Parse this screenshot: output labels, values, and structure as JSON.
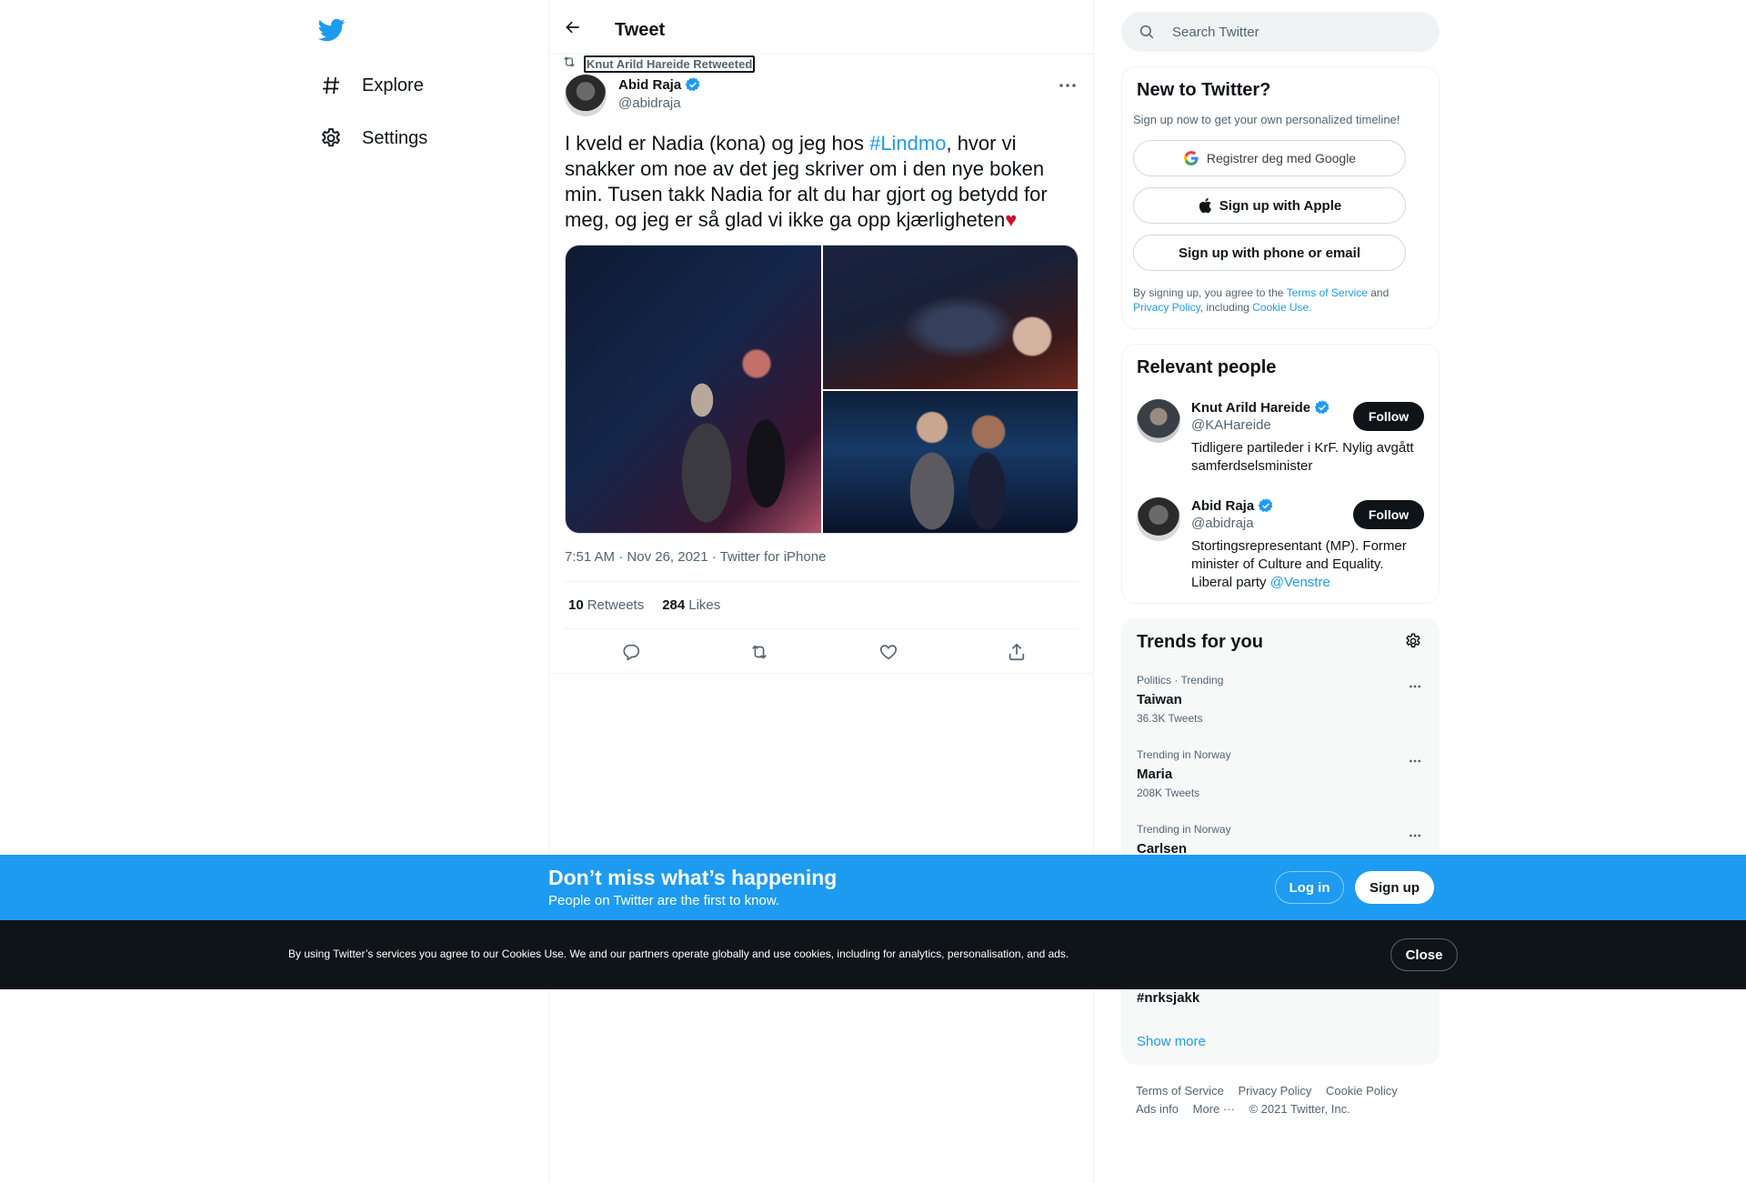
{
  "nav": {
    "explore_label": "Explore",
    "settings_label": "Settings"
  },
  "header": {
    "title": "Tweet"
  },
  "tweet": {
    "retweeted_by": "Knut Arild Hareide Retweeted",
    "author_name": "Abid Raja",
    "author_handle": "@abidraja",
    "text_part1": "I kveld er Nadia (kona) og jeg hos ",
    "hashtag": "#Lindmo",
    "text_part2": ", hvor vi snakker om noe av det jeg skriver om i den nye boken min. Tusen takk Nadia for alt du har gjort og betydd for meg, og jeg er så glad vi ikke ga opp kjærligheten",
    "emoji": "♥",
    "time": "7:51 AM",
    "date": "Nov 26, 2021",
    "source": "Twitter for iPhone",
    "retweets_count": "10",
    "retweets_label": "Retweets",
    "likes_count": "284",
    "likes_label": "Likes"
  },
  "search": {
    "placeholder": "Search Twitter"
  },
  "new_to_twitter": {
    "title": "New to Twitter?",
    "subtitle": "Sign up now to get your own personalized timeline!",
    "google_label": "Registrer deg med Google",
    "apple_label": "Sign up with Apple",
    "phone_label": "Sign up with phone or email",
    "terms_prefix": "By signing up, you agree to the ",
    "terms_link": "Terms of Service",
    "terms_and": " and ",
    "privacy_link": "Privacy Policy",
    "terms_including": ", including ",
    "cookie_link": "Cookie Use."
  },
  "relevant_people": {
    "title": "Relevant people",
    "people": [
      {
        "name": "Knut Arild Hareide",
        "handle": "@KAHareide",
        "bio": "Tidligere partileder i KrF. Nylig avgått samferdselsminister",
        "follow_label": "Follow"
      },
      {
        "name": "Abid Raja",
        "handle": "@abidraja",
        "bio": "Stortingsrepresentant (MP). Former minister of Culture and Equality. Liberal party ",
        "bio_link": "@Venstre",
        "follow_label": "Follow"
      }
    ]
  },
  "trends": {
    "title": "Trends for you",
    "items": [
      {
        "context": "Politics · Trending",
        "name": "Taiwan",
        "count": "36.3K Tweets"
      },
      {
        "context": "Trending in Norway",
        "name": "Maria",
        "count": "208K Tweets"
      },
      {
        "context": "Trending in Norway",
        "name": "Carlsen",
        "count": ""
      }
    ],
    "last_visible": "#nrksjakk",
    "show_more": "Show more"
  },
  "footer": {
    "terms": "Terms of Service",
    "privacy": "Privacy Policy",
    "cookie": "Cookie Policy",
    "ads": "Ads info",
    "more": "More ···",
    "copyright": "© 2021 Twitter, Inc."
  },
  "signup_bar": {
    "title": "Don’t miss what’s happening",
    "subtitle": "People on Twitter are the first to know.",
    "login_label": "Log in",
    "signup_label": "Sign up"
  },
  "cookie_bar": {
    "text": "By using Twitter’s services you agree to our Cookies Use. We and our partners operate globally and use cookies, including for analytics, personalisation, and ads.",
    "close_label": "Close"
  },
  "colors": {
    "accent": "#1d9bf0",
    "text": "#0f1419",
    "muted": "#536471",
    "heart": "#d0102b"
  }
}
